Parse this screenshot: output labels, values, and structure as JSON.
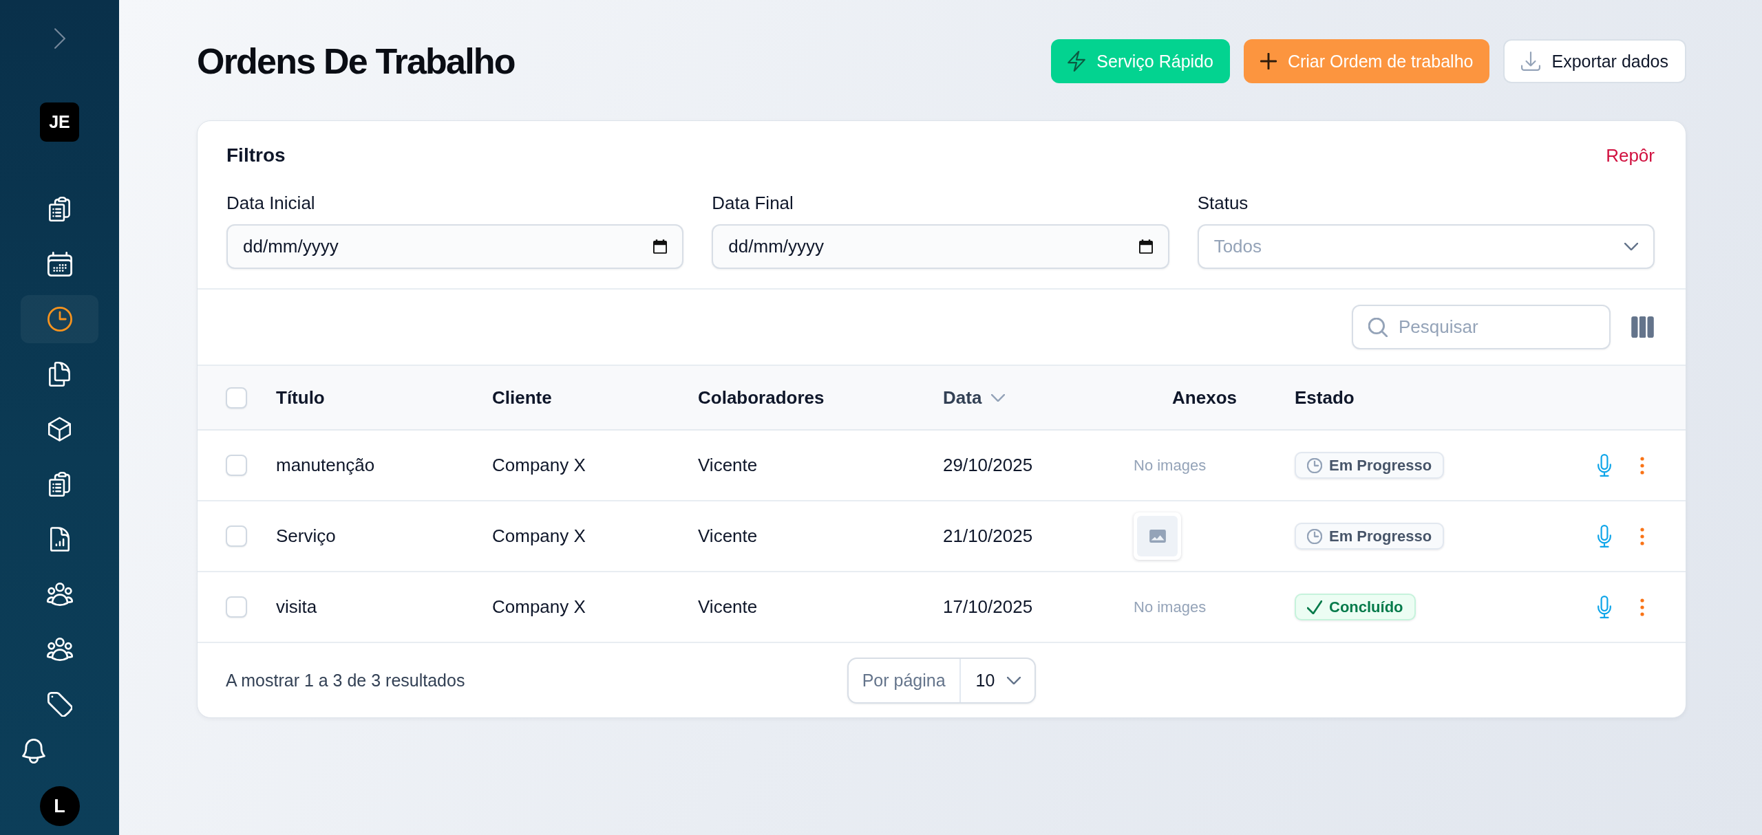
{
  "sidebar": {
    "workspace_avatar": "JE",
    "nav_items": [
      {
        "selected": false
      },
      {
        "selected": false
      },
      {
        "selected": true
      },
      {
        "selected": false
      },
      {
        "selected": false
      },
      {
        "selected": false
      },
      {
        "selected": false
      },
      {
        "selected": false
      },
      {
        "selected": false
      },
      {
        "selected": false
      }
    ],
    "user_avatar": "L"
  },
  "header": {
    "title": "Ordens De Trabalho",
    "actions": [
      {
        "kind": "quick",
        "label": "Serviço Rápido"
      },
      {
        "kind": "create",
        "label": "Criar Ordem de trabalho"
      },
      {
        "kind": "export",
        "label": "Exportar dados"
      }
    ]
  },
  "filters": {
    "title": "Filtros",
    "reset": "Repôr",
    "fields": [
      {
        "kind": "date",
        "label": "Data Inicial",
        "placeholder": "dd/mm/yyyy"
      },
      {
        "kind": "date",
        "label": "Data Final",
        "placeholder": "dd/mm/yyyy"
      },
      {
        "kind": "select",
        "label": "Status",
        "placeholder": "Todos"
      }
    ]
  },
  "toolbar": {
    "search": {
      "placeholder": "Pesquisar"
    }
  },
  "table": {
    "all_selected": false,
    "columns": [
      {
        "label": "Título",
        "sorted": false
      },
      {
        "label": "Cliente",
        "sorted": false
      },
      {
        "label": "Colaboradores",
        "sorted": false
      },
      {
        "label": "Data",
        "sorted": true
      },
      {
        "label": "Anexos",
        "sorted": false
      },
      {
        "label": "Estado",
        "sorted": false
      }
    ],
    "rows": [
      {
        "selected": false,
        "title": "manutenção",
        "client": "Company X",
        "collaborators": "Vicente",
        "date": "29/10/2025",
        "attachments": {
          "kind": "none",
          "text": "No images"
        },
        "status": {
          "kind": "in_progress",
          "label": "Em Progresso"
        }
      },
      {
        "selected": false,
        "title": "Serviço",
        "client": "Company X",
        "collaborators": "Vicente",
        "date": "21/10/2025",
        "attachments": {
          "kind": "image"
        },
        "status": {
          "kind": "in_progress",
          "label": "Em Progresso"
        }
      },
      {
        "selected": false,
        "title": "visita",
        "client": "Company X",
        "collaborators": "Vicente",
        "date": "17/10/2025",
        "attachments": {
          "kind": "none",
          "text": "No images"
        },
        "status": {
          "kind": "done",
          "label": "Concluído"
        }
      }
    ]
  },
  "footer": {
    "summary": "A mostrar 1 a 3 de 3 resultados",
    "per_page_label": "Por página",
    "per_page_value": "10"
  }
}
